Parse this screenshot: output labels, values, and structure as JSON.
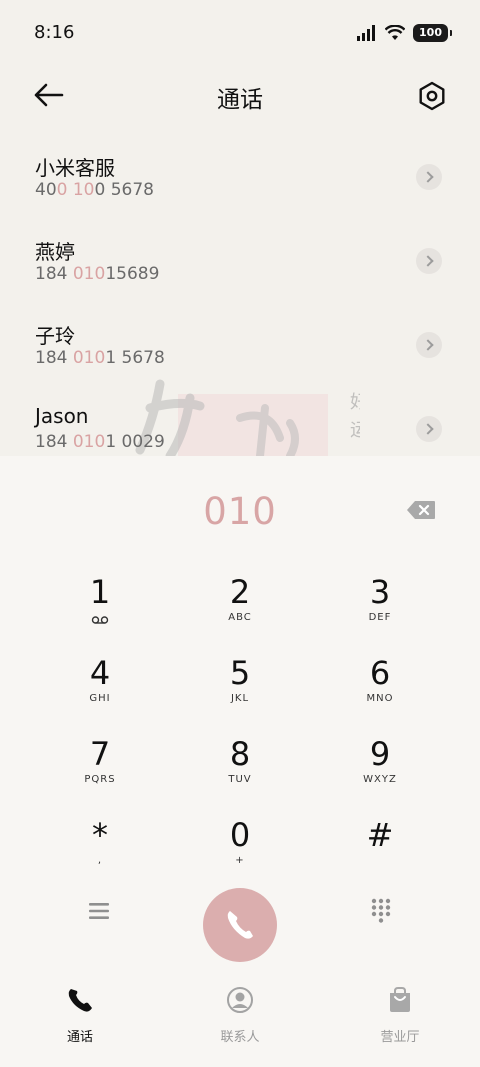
{
  "status": {
    "time": "8:16",
    "battery": "100"
  },
  "header": {
    "title": "通话"
  },
  "contacts": [
    {
      "name": "小米客服",
      "number_parts": [
        "40",
        "0 10",
        "0 5678"
      ]
    },
    {
      "name": "燕婷",
      "number_parts": [
        "184 ",
        "010",
        "15689"
      ]
    },
    {
      "name": "子玲",
      "number_parts": [
        "184 ",
        "010",
        "1 5678"
      ]
    },
    {
      "name": "Jason",
      "number_parts": [
        "184 ",
        "010",
        "1 0029"
      ]
    }
  ],
  "dialer": {
    "entered": "010",
    "keys": [
      {
        "digit": "1",
        "letters": ""
      },
      {
        "digit": "2",
        "letters": "ABC"
      },
      {
        "digit": "3",
        "letters": "DEF"
      },
      {
        "digit": "4",
        "letters": "GHI"
      },
      {
        "digit": "5",
        "letters": "JKL"
      },
      {
        "digit": "6",
        "letters": "MNO"
      },
      {
        "digit": "7",
        "letters": "PQRS"
      },
      {
        "digit": "8",
        "letters": "TUV"
      },
      {
        "digit": "9",
        "letters": "WXYZ"
      },
      {
        "digit": "*",
        "letters": ","
      },
      {
        "digit": "0",
        "letters": "+"
      },
      {
        "digit": "#",
        "letters": ""
      }
    ]
  },
  "nav": {
    "tabs": [
      "通话",
      "联系人",
      "营业厅"
    ]
  },
  "colors": {
    "accent": "#d9a3a3",
    "call_button": "#dbaeae"
  },
  "icons": [
    "signal-icon",
    "wifi-icon",
    "battery-icon",
    "back-arrow-icon",
    "settings-icon",
    "chevron-right-icon",
    "backspace-icon",
    "voicemail-icon",
    "menu-icon",
    "phone-icon",
    "keypad-icon",
    "contacts-icon",
    "store-icon"
  ]
}
